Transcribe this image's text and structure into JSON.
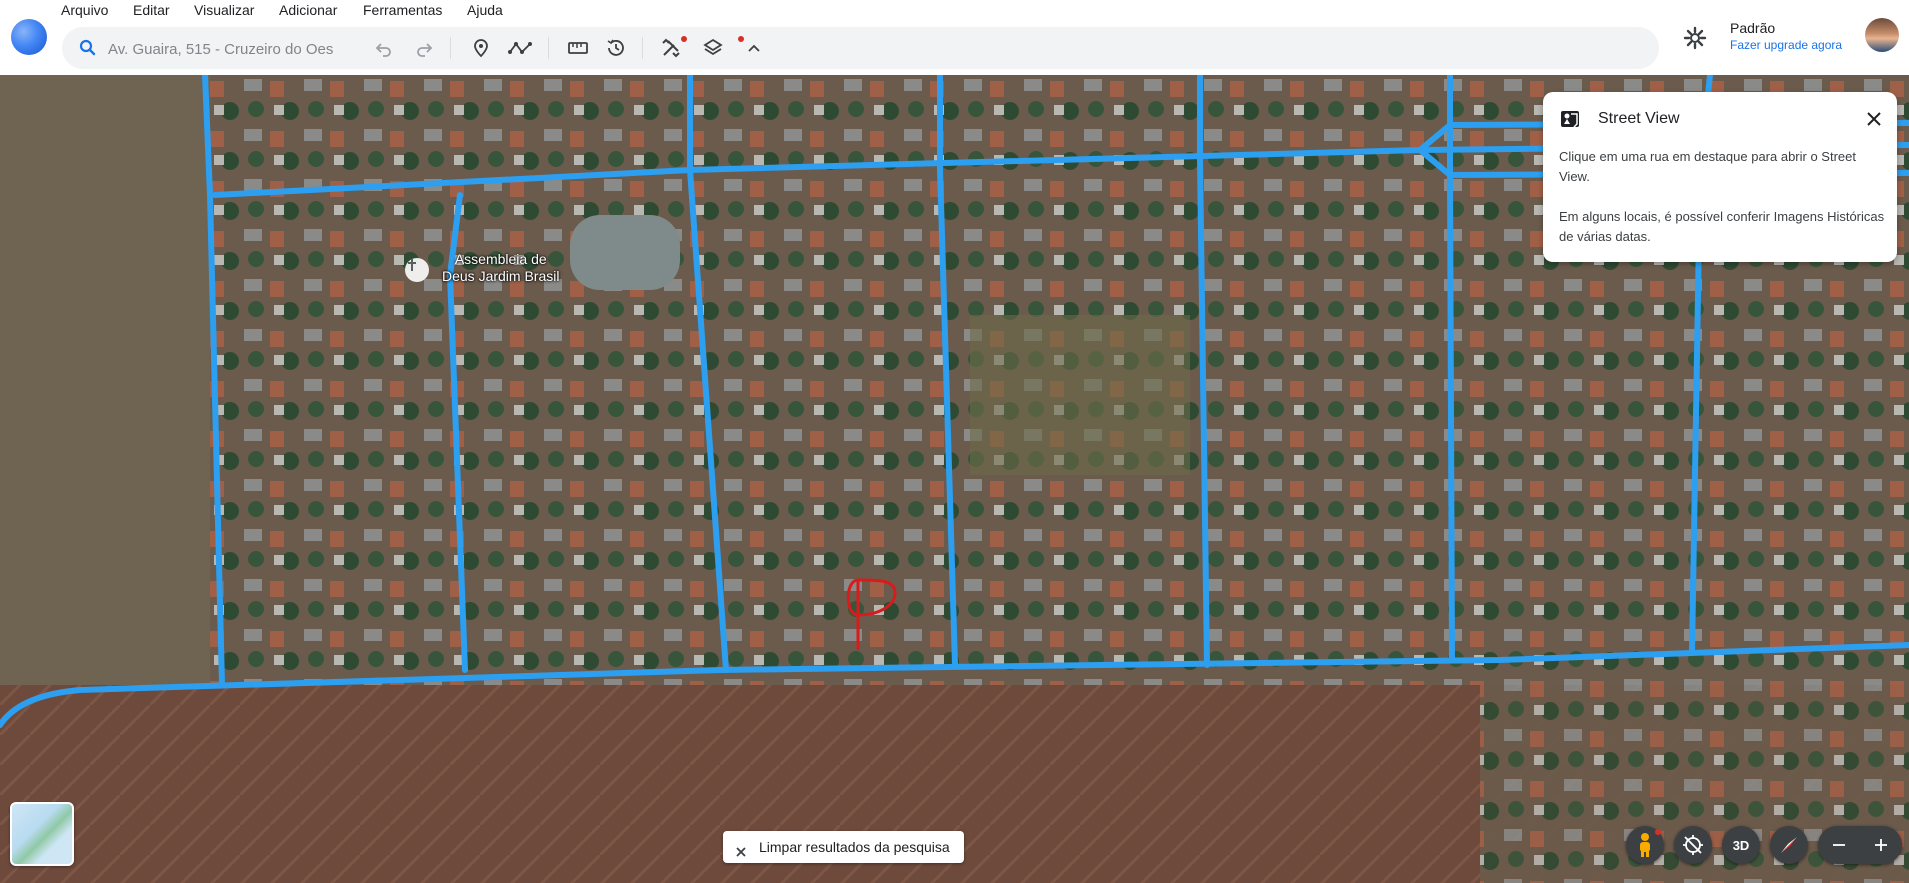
{
  "menu": {
    "items": [
      {
        "label": "Arquivo"
      },
      {
        "label": "Editar"
      },
      {
        "label": "Visualizar"
      },
      {
        "label": "Adicionar"
      },
      {
        "label": "Ferramentas"
      },
      {
        "label": "Ajuda"
      }
    ]
  },
  "toolbar": {
    "search_value": "Av. Guaira, 515 - Cruzeiro do Oes",
    "icons": [
      "search-icon",
      "undo-icon",
      "redo-icon",
      "placemark-icon",
      "path-icon",
      "ruler-icon",
      "historical-imagery-icon",
      "tools-icon",
      "layers-icon",
      "collapse-icon"
    ]
  },
  "profile": {
    "name": "Padrão",
    "upgrade_label": "Fazer upgrade agora"
  },
  "map": {
    "poi_label_line1": "Assembleia de",
    "poi_label_line2": "Deus Jardim Brasil",
    "road_color": "#2c9ff0",
    "marker_color": "#d81b1b"
  },
  "street_view": {
    "title": "Street View",
    "text1": "Clique em uma rua em destaque para abrir o Street View.",
    "text2": "Em alguns locais, é possível conferir Imagens Históricas de várias datas."
  },
  "bottom": {
    "clear_label": "Limpar resultados da pesquisa",
    "three_d_label": "3D"
  },
  "colors": {
    "accent": "#1a73e8",
    "control_bg": "#3c4043"
  }
}
